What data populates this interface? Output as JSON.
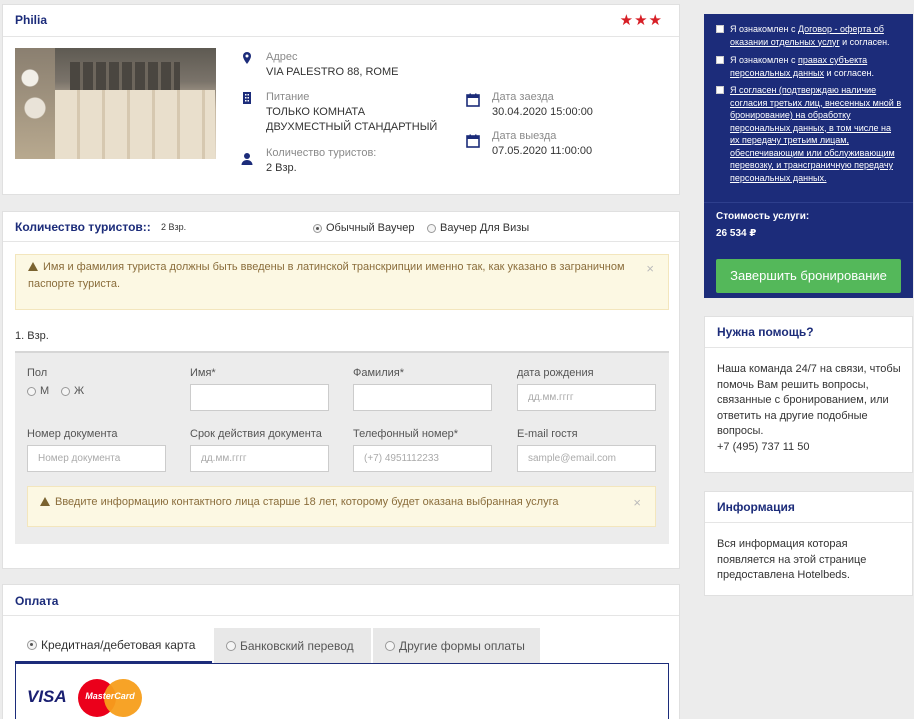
{
  "hotel": {
    "name": "Philia",
    "stars": "★★★",
    "address_label": "Адрес",
    "address_value": "VIA PALESTRO 88, ROME",
    "meal_label": "Питание",
    "meal_value": "ТОЛЬКО КОМНАТА",
    "room_value": "ДВУХМЕСТНЫЙ СТАНДАРТНЫЙ",
    "tourists_label": "Количество туристов:",
    "tourists_value": "2 Взр.",
    "checkin_label": "Дата заезда",
    "checkin_value": "30.04.2020 15:00:00",
    "checkout_label": "Дата выезда",
    "checkout_value": "07.05.2020 11:00:00"
  },
  "tourists": {
    "title": "Количество туристов::",
    "count": "2 Взр.",
    "voucher_regular": "Обычный Ваучер",
    "voucher_visa": "Ваучер Для Визы",
    "alert_latin": "Имя и фамилия туриста должны быть введены в латинской транскрипции именно так, как указано в заграничном паспорте туриста.",
    "alert_close": "×",
    "adult_label": "1. Взр.",
    "form": {
      "gender_label": "Пол",
      "gender_m": "М",
      "gender_f": "Ж",
      "first_name_label": "Имя*",
      "last_name_label": "Фамилия*",
      "birth_label": "дата рождения",
      "birth_placeholder": "дд.мм.гггг",
      "doc_number_label": "Номер документа",
      "doc_number_placeholder": "Номер документа",
      "doc_expiry_label": "Срок действия документа",
      "doc_expiry_placeholder": "дд.мм.гггг",
      "phone_label": "Телефонный номер*",
      "phone_placeholder": "(+7) 4951112233",
      "email_label": "E-mail гостя",
      "email_placeholder": "sample@email.com"
    },
    "alert_contact": "Введите информацию контактного лица старше 18 лет, которому будет оказана выбранная услуга"
  },
  "payment": {
    "title": "Оплата",
    "tab_card": "Кредитная/дебетовая карта",
    "tab_bank": "Банковский перевод",
    "tab_other": "Другие формы оплаты",
    "visa": "VISA",
    "mastercard": "MasterCard"
  },
  "agreement": {
    "c1_pre": "Я ознакомлен с ",
    "c1_link": "Договор - оферта об оказании отдельных услуг",
    "c1_post": " и согласен.",
    "c2_pre": "Я ознакомлен с ",
    "c2_link": "правах субъекта персональных данных",
    "c2_post": " и согласен.",
    "c3": "Я согласен (подтверждаю наличие согласия третьих лиц, внесенных мной в бронирование) на обработку персональных данных, в том числе на их передачу третьим лицам, обеспечивающим или обслуживающим перевозку, и трансграничную передачу персональных данных.",
    "cost_label": "Стоимость услуги:",
    "cost_value": "26 534 ₽",
    "submit": "Завершить бронирование"
  },
  "help": {
    "title": "Нужна помощь?",
    "text": "Наша команда 24/7 на связи, чтобы помочь Вам решить вопросы, связанные с бронированием, или ответить на другие подобные вопросы.",
    "phone": "+7 (495) 737 11 50"
  },
  "info": {
    "title": "Информация",
    "text": "Вся информация которая появляется на этой странице предоставлена Hotelbeds."
  },
  "colors": {
    "brand": "#1c2c7a",
    "accent_green": "#54b85a",
    "stars": "#d71f26"
  }
}
